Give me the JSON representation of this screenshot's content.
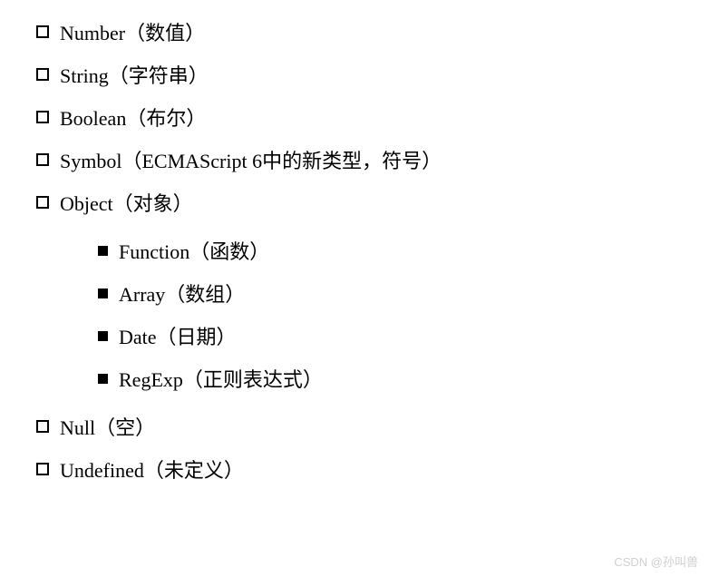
{
  "items": [
    {
      "text": "Number（数值）"
    },
    {
      "text": "String（字符串）"
    },
    {
      "text": "Boolean（布尔）"
    },
    {
      "text": "Symbol（ECMAScript 6中的新类型，符号）"
    },
    {
      "text": "Object（对象）",
      "children": [
        {
          "text": "Function（函数）"
        },
        {
          "text": "Array（数组）"
        },
        {
          "text": "Date（日期）"
        },
        {
          "text": "RegExp（正则表达式）"
        }
      ]
    },
    {
      "text": "Null（空）"
    },
    {
      "text": "Undefined（未定义）"
    }
  ],
  "watermark": "CSDN @孙叫兽"
}
